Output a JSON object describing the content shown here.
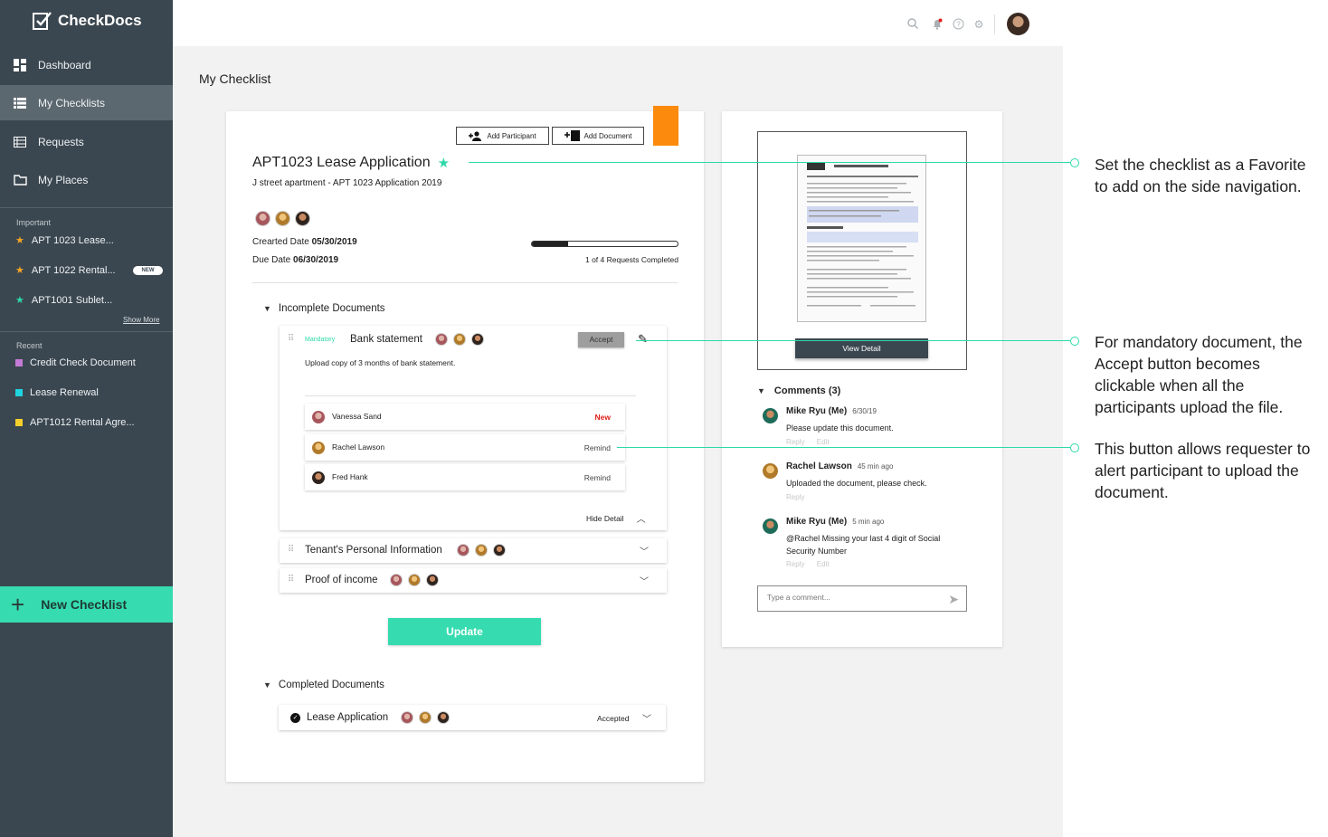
{
  "app": {
    "name": "CheckDocs"
  },
  "sidebar": {
    "nav": [
      {
        "label": "Dashboard",
        "icon": "dashboard-icon"
      },
      {
        "label": "My Checklists",
        "icon": "list-icon",
        "active": true
      },
      {
        "label": "Requests",
        "icon": "requests-icon"
      },
      {
        "label": "My Places",
        "icon": "folder-icon"
      }
    ],
    "important_label": "Important",
    "important": [
      {
        "label": "APT 1023 Lease...",
        "star": "#f5a623"
      },
      {
        "label": "APT 1022 Rental...",
        "star": "#f5a623",
        "badge": "NEW"
      },
      {
        "label": "APT1001 Sublet...",
        "star": "#2bd9a8"
      }
    ],
    "show_more": "Show More",
    "recent_label": "Recent",
    "recent": [
      {
        "label": "Credit Check Document",
        "color": "#c47bd6"
      },
      {
        "label": "Lease Renewal",
        "color": "#1fd3e0"
      },
      {
        "label": "APT1012  Rental Agre...",
        "color": "#f7d02c"
      }
    ],
    "new_checklist": "New Checklist"
  },
  "header": {
    "page_title": "My Checklist"
  },
  "checklist": {
    "add_participant": "Add Participant",
    "add_document": "Add Document",
    "title": "APT1023 Lease Application",
    "subtitle": "J street apartment - APT 1023 Application 2019",
    "created_label": "Crearted Date",
    "created_date": "05/30/2019",
    "due_label": "Due Date",
    "due_date": "06/30/2019",
    "progress_fraction": 0.25,
    "progress_label": "1 of 4 Requests Completed",
    "incomplete_heading": "Incomplete Documents",
    "bank": {
      "tag": "Mandatory",
      "name": "Bank statement",
      "accept": "Accept",
      "description": "Upload copy of 3 months of bank statement.",
      "participants": [
        {
          "name": "Vanessa Sand",
          "status": "New"
        },
        {
          "name": "Rachel Lawson",
          "status": "Remind"
        },
        {
          "name": "Fred Hank",
          "status": "Remind"
        }
      ],
      "hide_detail": "Hide Detail"
    },
    "tenant_doc": "Tenant's Personal Information",
    "income_doc": "Proof of income",
    "update": "Update",
    "completed_heading": "Completed Documents",
    "lease_doc": "Lease Application",
    "lease_status": "Accepted"
  },
  "preview": {
    "view_detail": "View Detail",
    "comments_heading": "Comments (3)",
    "comments": [
      {
        "author": "Mike Ryu (Me)",
        "time": "6/30/19",
        "text": "Please update this document.",
        "reply": "Reply",
        "edit": "Edit"
      },
      {
        "author": "Rachel Lawson",
        "time": "45 min ago",
        "text": "Uploaded the document, please check.",
        "reply": "Reply"
      },
      {
        "author": "Mike Ryu (Me)",
        "time": "5 min ago",
        "text": "@Rachel  Missing your last 4 digit of Social Security Number",
        "reply": "Reply",
        "edit": "Edit"
      }
    ],
    "comment_placeholder": "Type a comment..."
  },
  "annotations": [
    "Set the checklist as a Favorite to add on the side navigation.",
    "For mandatory document, the Accept button becomes clickable when all the participants upload the file.",
    "This button allows requester to alert participant to upload the document."
  ],
  "colors": {
    "accent": "#36dcb0",
    "sidebar": "#3b4750",
    "orange": "#fb8a0d",
    "alert": "#e0201b"
  }
}
